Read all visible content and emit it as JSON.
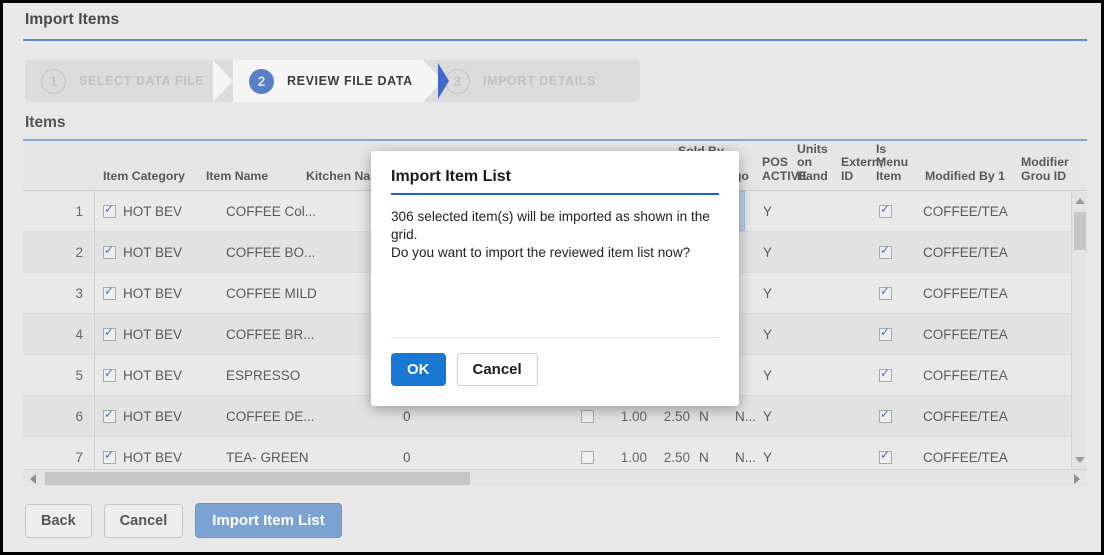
{
  "page": {
    "title": "Import Items",
    "section_title": "Items"
  },
  "stepper": {
    "steps": [
      {
        "number": "1",
        "label": "SELECT DATA FILE",
        "state": "inactive"
      },
      {
        "number": "2",
        "label": "REVIEW FILE DATA",
        "state": "active"
      },
      {
        "number": "3",
        "label": "IMPORT DETAILS",
        "state": "inactive"
      }
    ]
  },
  "grid": {
    "columns": [
      {
        "key": "item_category",
        "label": "Item Category"
      },
      {
        "key": "item_name",
        "label": "Item Name"
      },
      {
        "key": "kitchen_name",
        "label": "Kitchen Nam"
      },
      {
        "key": "sold_by",
        "label": "Sold By"
      },
      {
        "key": "category",
        "label": "ego"
      },
      {
        "key": "pos_active",
        "label": "POS ACTIVE"
      },
      {
        "key": "units_on_hand",
        "label": "Units on Hand"
      },
      {
        "key": "external_id",
        "label": "Extern; ID"
      },
      {
        "key": "is_menu_item",
        "label": "Is Menu Item"
      },
      {
        "key": "modified_by_1",
        "label": "Modified By 1"
      },
      {
        "key": "modifier_group_id",
        "label": "Modifier Grou ID"
      }
    ],
    "rows": [
      {
        "n": "1",
        "checked": true,
        "item_category": "HOT BEV",
        "item_name": "COFFEE Col...",
        "kitchen_name": "",
        "num1": "",
        "num2": "",
        "f1": "",
        "f2": "",
        "pos_active": "Y",
        "is_menu_item": true,
        "modified_by_1": "COFFEE/TEA",
        "selected_cell": true
      },
      {
        "n": "2",
        "checked": true,
        "item_category": "HOT BEV",
        "item_name": "COFFEE BO...",
        "kitchen_name": "",
        "num1": "",
        "num2": "",
        "f1": "",
        "f2": "",
        "pos_active": "Y",
        "is_menu_item": true,
        "modified_by_1": "COFFEE/TEA",
        "selected_cell": false
      },
      {
        "n": "3",
        "checked": true,
        "item_category": "HOT BEV",
        "item_name": "COFFEE MILD",
        "kitchen_name": "",
        "num1": "",
        "num2": "",
        "f1": "",
        "f2": "",
        "pos_active": "Y",
        "is_menu_item": true,
        "modified_by_1": "COFFEE/TEA",
        "selected_cell": false
      },
      {
        "n": "4",
        "checked": true,
        "item_category": "HOT BEV",
        "item_name": "COFFEE BR...",
        "kitchen_name": "",
        "num1": "",
        "num2": "",
        "f1": "",
        "f2": "",
        "pos_active": "Y",
        "is_menu_item": true,
        "modified_by_1": "COFFEE/TEA",
        "selected_cell": false
      },
      {
        "n": "5",
        "checked": true,
        "item_category": "HOT BEV",
        "item_name": "ESPRESSO",
        "kitchen_name": "",
        "num1": "",
        "num2": "",
        "f1": "",
        "f2": "",
        "pos_active": "Y",
        "is_menu_item": true,
        "modified_by_1": "COFFEE/TEA",
        "selected_cell": false
      },
      {
        "n": "6",
        "checked": true,
        "item_category": "HOT BEV",
        "item_name": "COFFEE DE...",
        "kitchen_name": "0",
        "num1": "1.00",
        "num2": "2.50",
        "f1": "N",
        "f2": "N...",
        "pos_active": "Y",
        "is_menu_item": true,
        "modified_by_1": "COFFEE/TEA",
        "selected_cell": false
      },
      {
        "n": "7",
        "checked": true,
        "item_category": "HOT BEV",
        "item_name": "TEA- GREEN",
        "kitchen_name": "0",
        "num1": "1.00",
        "num2": "2.50",
        "f1": "N",
        "f2": "N...",
        "pos_active": "Y",
        "is_menu_item": true,
        "modified_by_1": "COFFEE/TEA",
        "selected_cell": false
      }
    ]
  },
  "footer": {
    "back_label": "Back",
    "cancel_label": "Cancel",
    "import_label": "Import Item List"
  },
  "modal": {
    "title": "Import Item List",
    "line1": "306 selected item(s) will be imported as shown in the grid.",
    "line2": "Do you want to import the reviewed item list now?",
    "ok_label": "OK",
    "cancel_label": "Cancel"
  },
  "colors": {
    "accent_blue": "#5b8fd0",
    "modal_rule": "#1e66c4",
    "ok_button": "#1877d2",
    "primary_button": "#7aa3d4",
    "step_active": "#5b7fc4",
    "page_bg": "#e8e8e8"
  }
}
